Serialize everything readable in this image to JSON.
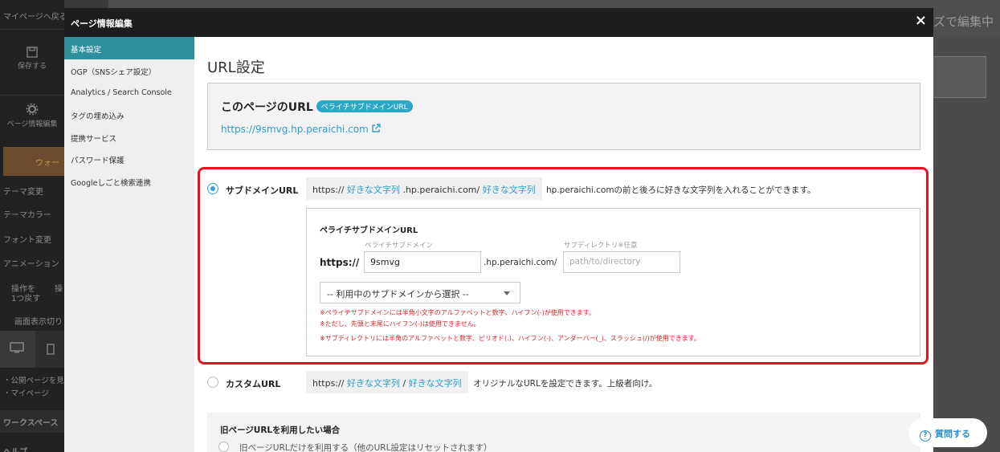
{
  "background": {
    "leftbar": {
      "back_link": "マイページへ戻る",
      "save": "保存する",
      "page_info": "ページ情報編集",
      "orange_label": "ウォー",
      "theme_change": "テーマ変更",
      "theme_color": "テーマカラー",
      "font_change": "フォント変更",
      "animation": "アニメーション",
      "undo_line1": "操作を",
      "undo_line2": "1つ戻す",
      "redo_mark": "操",
      "view_switch": "画面表示切り",
      "public_note": "・公開ページを見",
      "mypage": "・マイページ",
      "workspace": "ワークスペース",
      "help": "ヘルプ"
    },
    "right_text": "ズで編集中"
  },
  "modal": {
    "title": "ページ情報編集",
    "close": "×",
    "sidebar": [
      {
        "label": "基本設定",
        "active": true
      },
      {
        "label": "OGP（SNSシェア設定）",
        "active": false
      },
      {
        "label": "Analytics / Search Console",
        "active": false
      },
      {
        "label": "タグの埋め込み",
        "active": false
      },
      {
        "label": "提携サービス",
        "active": false
      },
      {
        "label": "パスワード保護",
        "active": false
      },
      {
        "label": "Googleしごと検索連携",
        "active": false
      }
    ],
    "section_title": "URL設定",
    "current_url": {
      "title": "このページのURL",
      "badge": "ペライチサブドメインURL",
      "link": "https://9smvg.hp.peraichi.com"
    },
    "subdomain_option": {
      "label": "サブドメインURL",
      "selected": true,
      "pattern_prefix": "https://",
      "pattern_hl1": "好きな文字列",
      "pattern_mid": ".hp.peraichi.com/",
      "pattern_hl2": "好きな文字列",
      "description": "hp.peraichi.comの前と後ろに好きな文字列を入れることができます。",
      "box_title": "ペライチサブドメインURL",
      "subdomain_label": "ペライチサブドメイン",
      "subdir_label": "サブディレクトリ※任意",
      "https": "https://",
      "subdomain_value": "9smvg",
      "domain_text": ".hp.peraichi.com/",
      "subdir_placeholder": "path/to/directory",
      "select_value": "-- 利用中のサブドメインから選択 --",
      "notes": [
        "※ペライチサブドメインには半角小文字のアルファベットと数字、ハイフン(-)が使用できます。",
        "※ただし、先頭と末尾にハイフン(-)は使用できません。",
        "※サブディレクトリには半角のアルファベットと数字、ピリオド(.)、ハイフン(-)、アンダーバー(_)、スラッシュ(/)が使用できます。"
      ]
    },
    "custom_option": {
      "label": "カスタムURL",
      "selected": false,
      "pattern_prefix": "https://",
      "pattern_hl1": "好きな文字列",
      "pattern_sep": "/",
      "pattern_hl2": "好きな文字列",
      "description": "オリジナルなURLを設定できます。上級者向け。"
    },
    "old_url": {
      "title": "旧ページURLを利用したい場合",
      "option": "旧ページURLだけを利用する（他のURL設定はリセットされます）"
    }
  },
  "help_button": "質問する",
  "colors": {
    "accent": "#2f8f9d",
    "link": "#2a9fd6",
    "error": "#d8262b",
    "highlight_frame": "#e3141e"
  }
}
